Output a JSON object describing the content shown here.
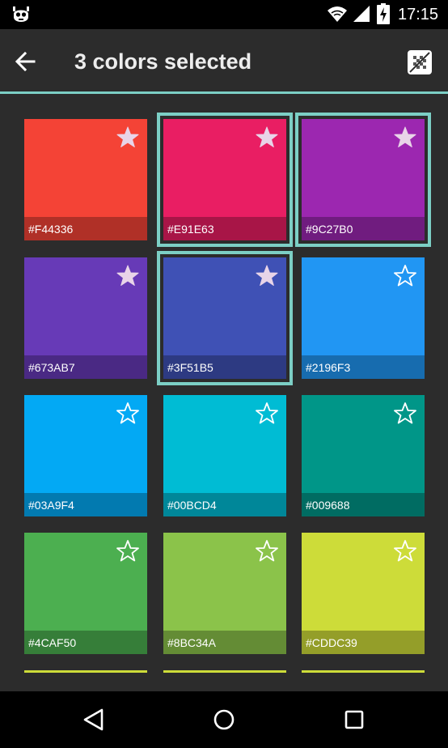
{
  "status_bar": {
    "time": "17:15"
  },
  "action_bar": {
    "title": "3 colors selected"
  },
  "colors": [
    {
      "hex": "#F44336",
      "color": "#F44336",
      "favorite": true,
      "selected": false
    },
    {
      "hex": "#E91E63",
      "color": "#E91E63",
      "favorite": true,
      "selected": true
    },
    {
      "hex": "#9C27B0",
      "color": "#9C27B0",
      "favorite": true,
      "selected": true
    },
    {
      "hex": "#673AB7",
      "color": "#673AB7",
      "favorite": true,
      "selected": false
    },
    {
      "hex": "#3F51B5",
      "color": "#3F51B5",
      "favorite": true,
      "selected": true
    },
    {
      "hex": "#2196F3",
      "color": "#2196F3",
      "favorite": false,
      "selected": false
    },
    {
      "hex": "#03A9F4",
      "color": "#03A9F4",
      "favorite": false,
      "selected": false
    },
    {
      "hex": "#00BCD4",
      "color": "#00BCD4",
      "favorite": false,
      "selected": false
    },
    {
      "hex": "#009688",
      "color": "#009688",
      "favorite": false,
      "selected": false
    },
    {
      "hex": "#4CAF50",
      "color": "#4CAF50",
      "favorite": false,
      "selected": false
    },
    {
      "hex": "#8BC34A",
      "color": "#8BC34A",
      "favorite": false,
      "selected": false
    },
    {
      "hex": "#CDDC39",
      "color": "#CDDC39",
      "favorite": false,
      "selected": false
    }
  ],
  "theme": {
    "accent": "#7ccfc5",
    "background": "#2c2c2c",
    "star_filled": "#e8d4e8",
    "star_outline": "#ffffff",
    "next_row_color": "#CDDC39"
  }
}
